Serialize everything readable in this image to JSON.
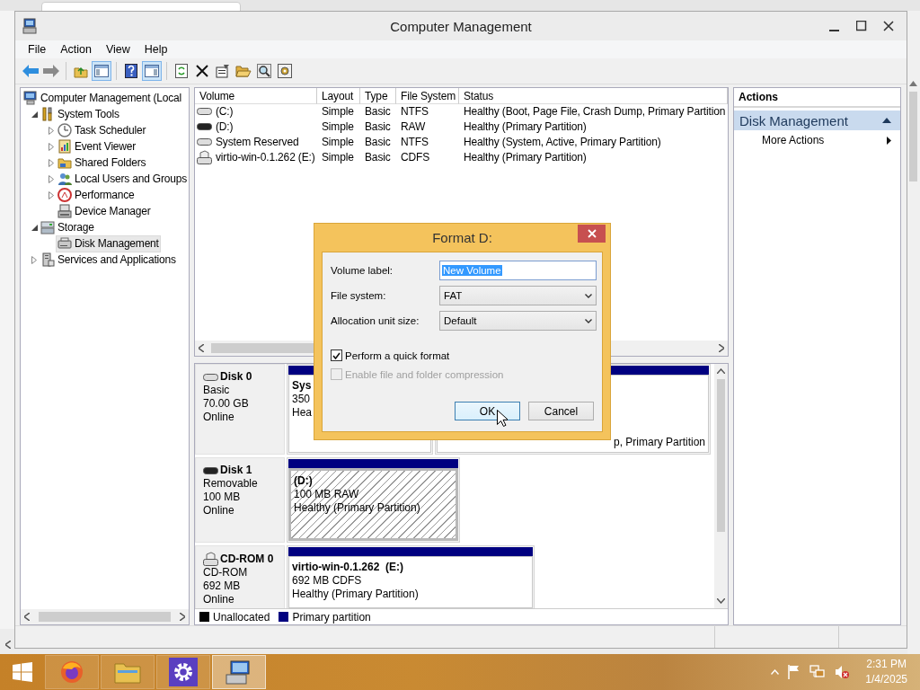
{
  "window": {
    "title": "Computer Management",
    "menu": [
      "File",
      "Action",
      "View",
      "Help"
    ]
  },
  "toolbar": {
    "console_tree_on": true,
    "action_pane_on": true
  },
  "tree": [
    {
      "label": "Computer Management (Local",
      "kind": "plain",
      "selected": false,
      "children": [
        {
          "label": "System Tools",
          "kind": "branch",
          "expanded": true,
          "selected": false,
          "children": [
            {
              "label": "Task Scheduler",
              "kind": "branch",
              "expanded": false,
              "selected": false
            },
            {
              "label": "Event Viewer",
              "kind": "branch",
              "expanded": false,
              "selected": false
            },
            {
              "label": "Shared Folders",
              "kind": "branch",
              "expanded": false,
              "selected": false
            },
            {
              "label": "Local Users and Groups",
              "kind": "branch",
              "expanded": false,
              "selected": false
            },
            {
              "label": "Performance",
              "kind": "branch",
              "expanded": false,
              "selected": false
            },
            {
              "label": "Device Manager",
              "kind": "plain",
              "selected": false
            }
          ]
        },
        {
          "label": "Storage",
          "kind": "branch",
          "expanded": true,
          "selected": false,
          "children": [
            {
              "label": "Disk Management",
              "kind": "plain",
              "selected": true
            }
          ]
        },
        {
          "label": "Services and Applications",
          "kind": "branch",
          "expanded": false,
          "selected": false
        }
      ]
    }
  ],
  "volume_table": {
    "columns": [
      "Volume",
      "Layout",
      "Type",
      "File System",
      "Status"
    ],
    "rows": [
      {
        "volume": "(C:)",
        "layout": "Simple",
        "type": "Basic",
        "file_system": "NTFS",
        "status": "Healthy (Boot, Page File, Crash Dump, Primary Partition"
      },
      {
        "volume": "(D:)",
        "layout": "Simple",
        "type": "Basic",
        "file_system": "RAW",
        "status": "Healthy (Primary Partition)"
      },
      {
        "volume": "System Reserved",
        "layout": "Simple",
        "type": "Basic",
        "file_system": "NTFS",
        "status": "Healthy (System, Active, Primary Partition)"
      },
      {
        "volume": "virtio-win-0.1.262 (E:)",
        "layout": "Simple",
        "type": "Basic",
        "file_system": "CDFS",
        "status": "Healthy (Primary Partition)"
      }
    ]
  },
  "disks": [
    {
      "name": "Disk 0",
      "kind": "fixed",
      "type": "Basic",
      "size": "70.00 GB",
      "status": "Online",
      "partitions": [
        {
          "kind": "primary",
          "name": "Sys",
          "detail": "350",
          "status": "Hea",
          "selected": false
        },
        {
          "kind": "primary",
          "status": "p, Primary Partition",
          "selected": false
        }
      ]
    },
    {
      "name": "Disk 1",
      "kind": "removable",
      "type": "Removable",
      "size": "100 MB",
      "status": "Online",
      "partitions": [
        {
          "kind": "primary",
          "name": "(D:)",
          "detail": "100 MB RAW",
          "status": "Healthy (Primary Partition)",
          "selected": true
        }
      ]
    },
    {
      "name": "CD-ROM 0",
      "kind": "cdrom",
      "type": "CD-ROM",
      "size": "692 MB",
      "status": "Online",
      "partitions": [
        {
          "kind": "primary",
          "name": "virtio-win-0.1.262  (E:)",
          "detail": "692 MB CDFS",
          "status": "Healthy (Primary Partition)",
          "selected": false
        }
      ]
    }
  ],
  "legend": [
    {
      "label": "Unallocated",
      "color": "#000000"
    },
    {
      "label": "Primary partition",
      "color": "#000080"
    }
  ],
  "actions": {
    "title": "Actions",
    "section": {
      "label": "Disk Management",
      "expanded": true
    },
    "items": [
      "More Actions"
    ]
  },
  "dialog": {
    "title": "Format D:",
    "fields": [
      {
        "kind": "text",
        "label": "Volume label:",
        "value": "New Volume",
        "text_selected": true
      },
      {
        "kind": "dropdown",
        "label": "File system:",
        "value": "FAT"
      },
      {
        "kind": "dropdown",
        "label": "Allocation unit size:",
        "value": "Default"
      }
    ],
    "options": [
      {
        "label": "Perform a quick format",
        "checked": true,
        "disabled": false
      },
      {
        "label": "Enable file and folder compression",
        "checked": false,
        "disabled": true
      }
    ],
    "buttons": [
      {
        "label": "OK",
        "default": true
      },
      {
        "label": "Cancel",
        "default": false
      }
    ]
  },
  "taskbar": {
    "apps": [
      {
        "selected": false
      },
      {
        "selected": false
      },
      {
        "selected": false
      },
      {
        "selected": true
      }
    ],
    "time": "2:31 PM",
    "date": "1/4/2025"
  }
}
